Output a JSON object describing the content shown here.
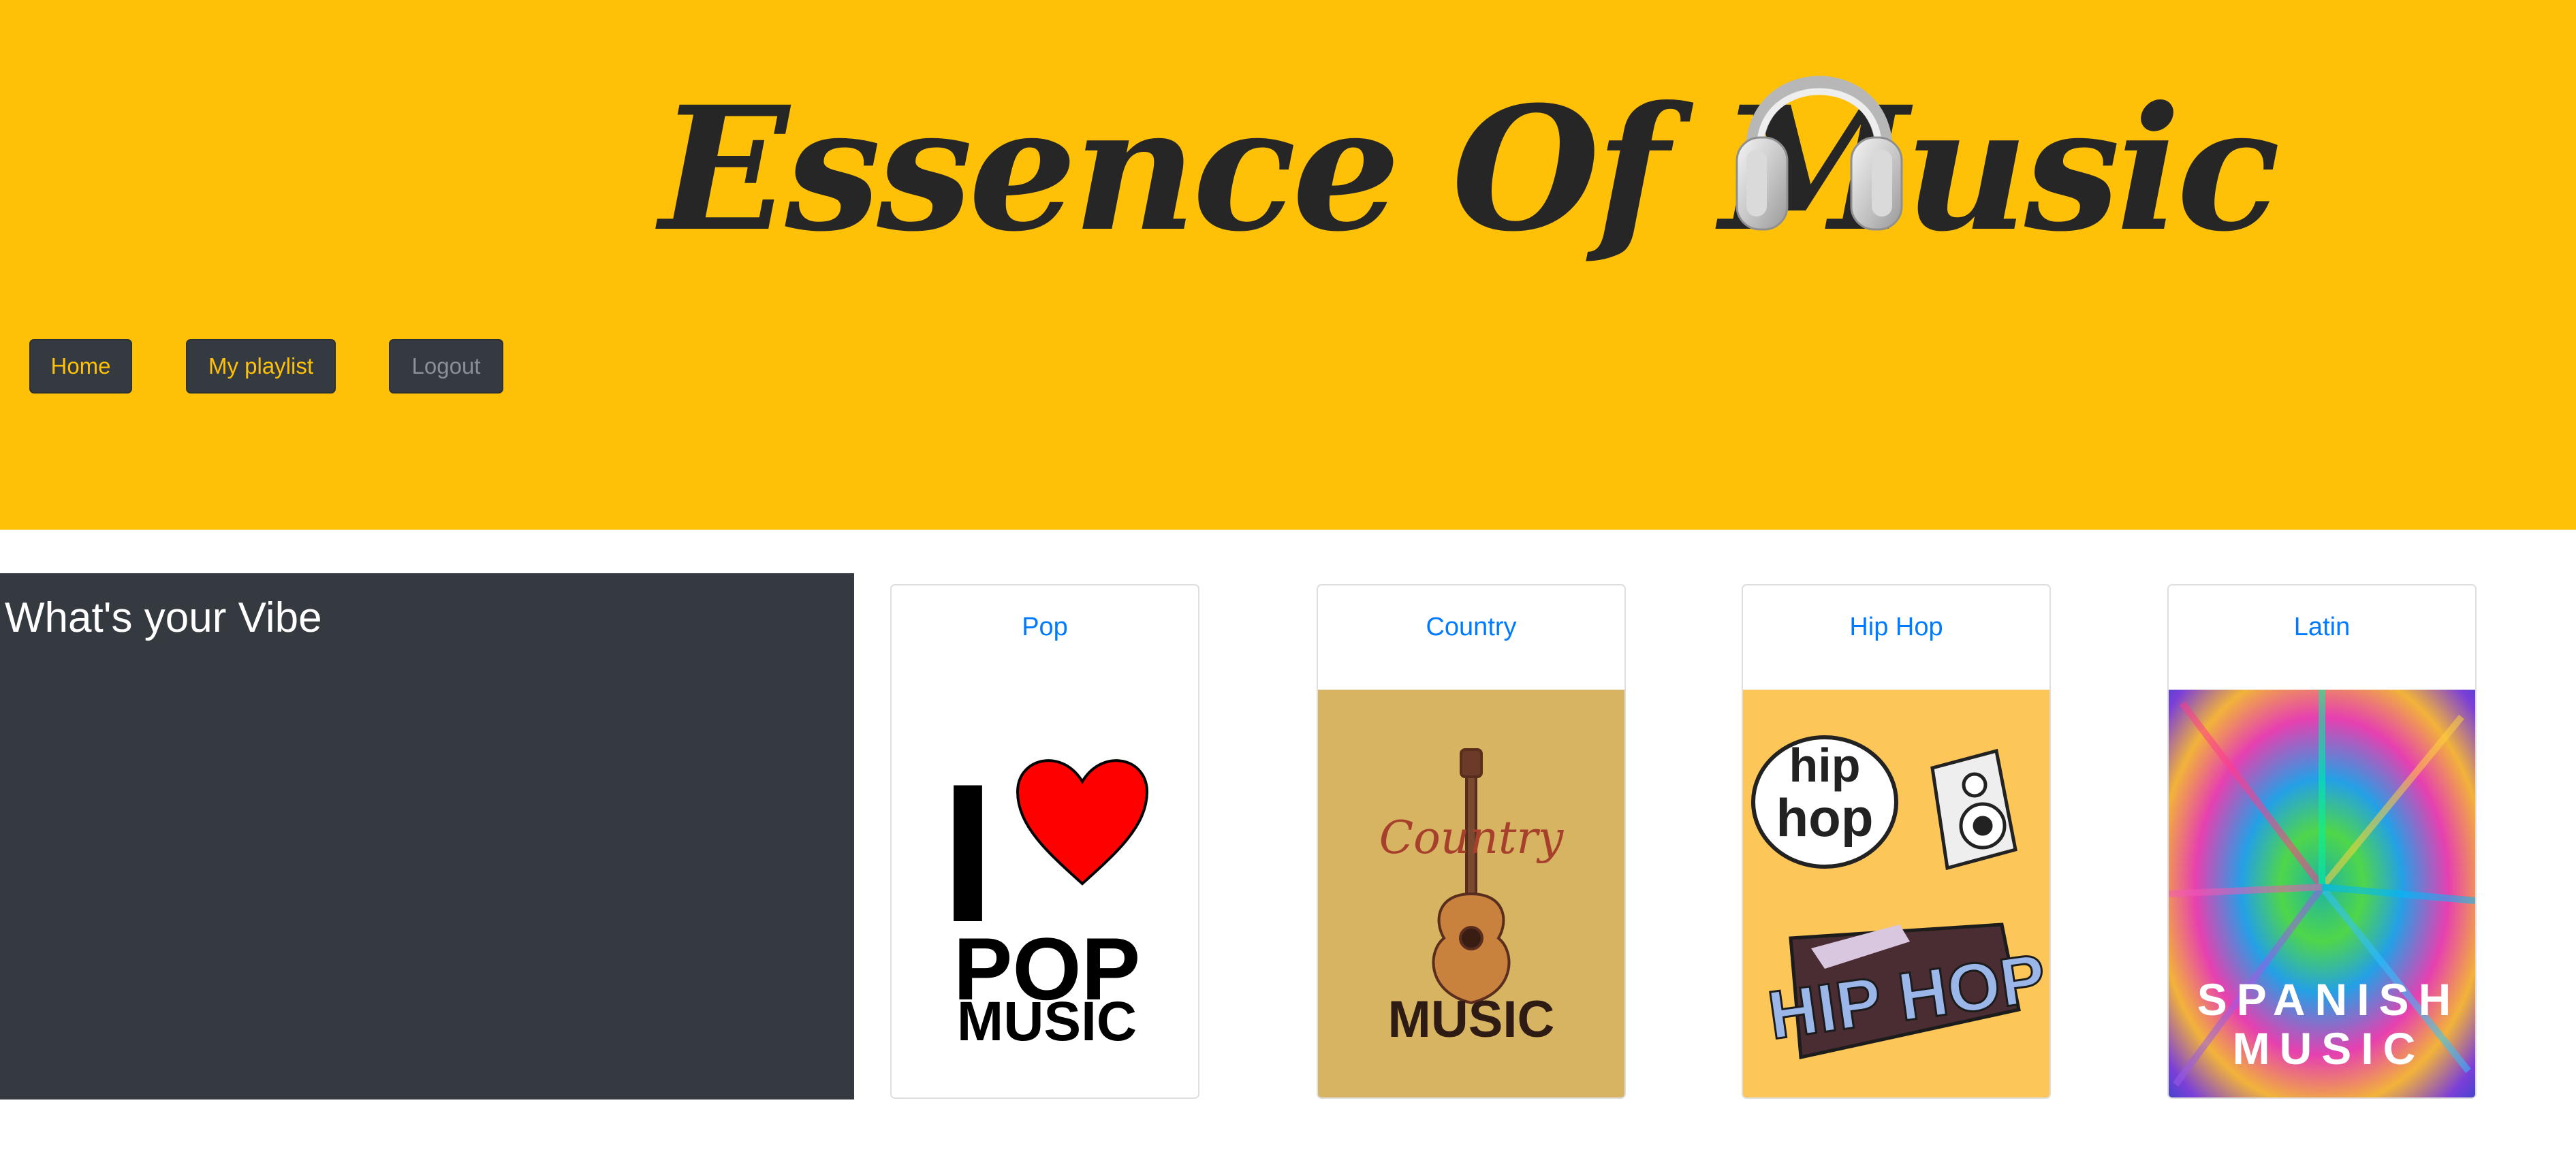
{
  "header": {
    "title": "Essence Of Music",
    "icon": "headphones-icon",
    "background": "#ffc107"
  },
  "nav": {
    "home_label": "Home",
    "playlist_label": "My playlist",
    "logout_label": "Logout"
  },
  "vibe_panel": {
    "heading": "What's your Vibe"
  },
  "genres": [
    {
      "label": "Pop",
      "image_text": [
        "I",
        "POP",
        "MUSIC"
      ]
    },
    {
      "label": "Country",
      "image_text": [
        "Country",
        "MUSIC"
      ]
    },
    {
      "label": "Hip Hop",
      "image_text": [
        "hip",
        "hop",
        "HIP HOP"
      ]
    },
    {
      "label": "Latin",
      "image_text": [
        "SPANISH",
        "MUSIC"
      ]
    }
  ],
  "colors": {
    "accent": "#ffc107",
    "dark": "#343a40",
    "link": "#007bff"
  }
}
